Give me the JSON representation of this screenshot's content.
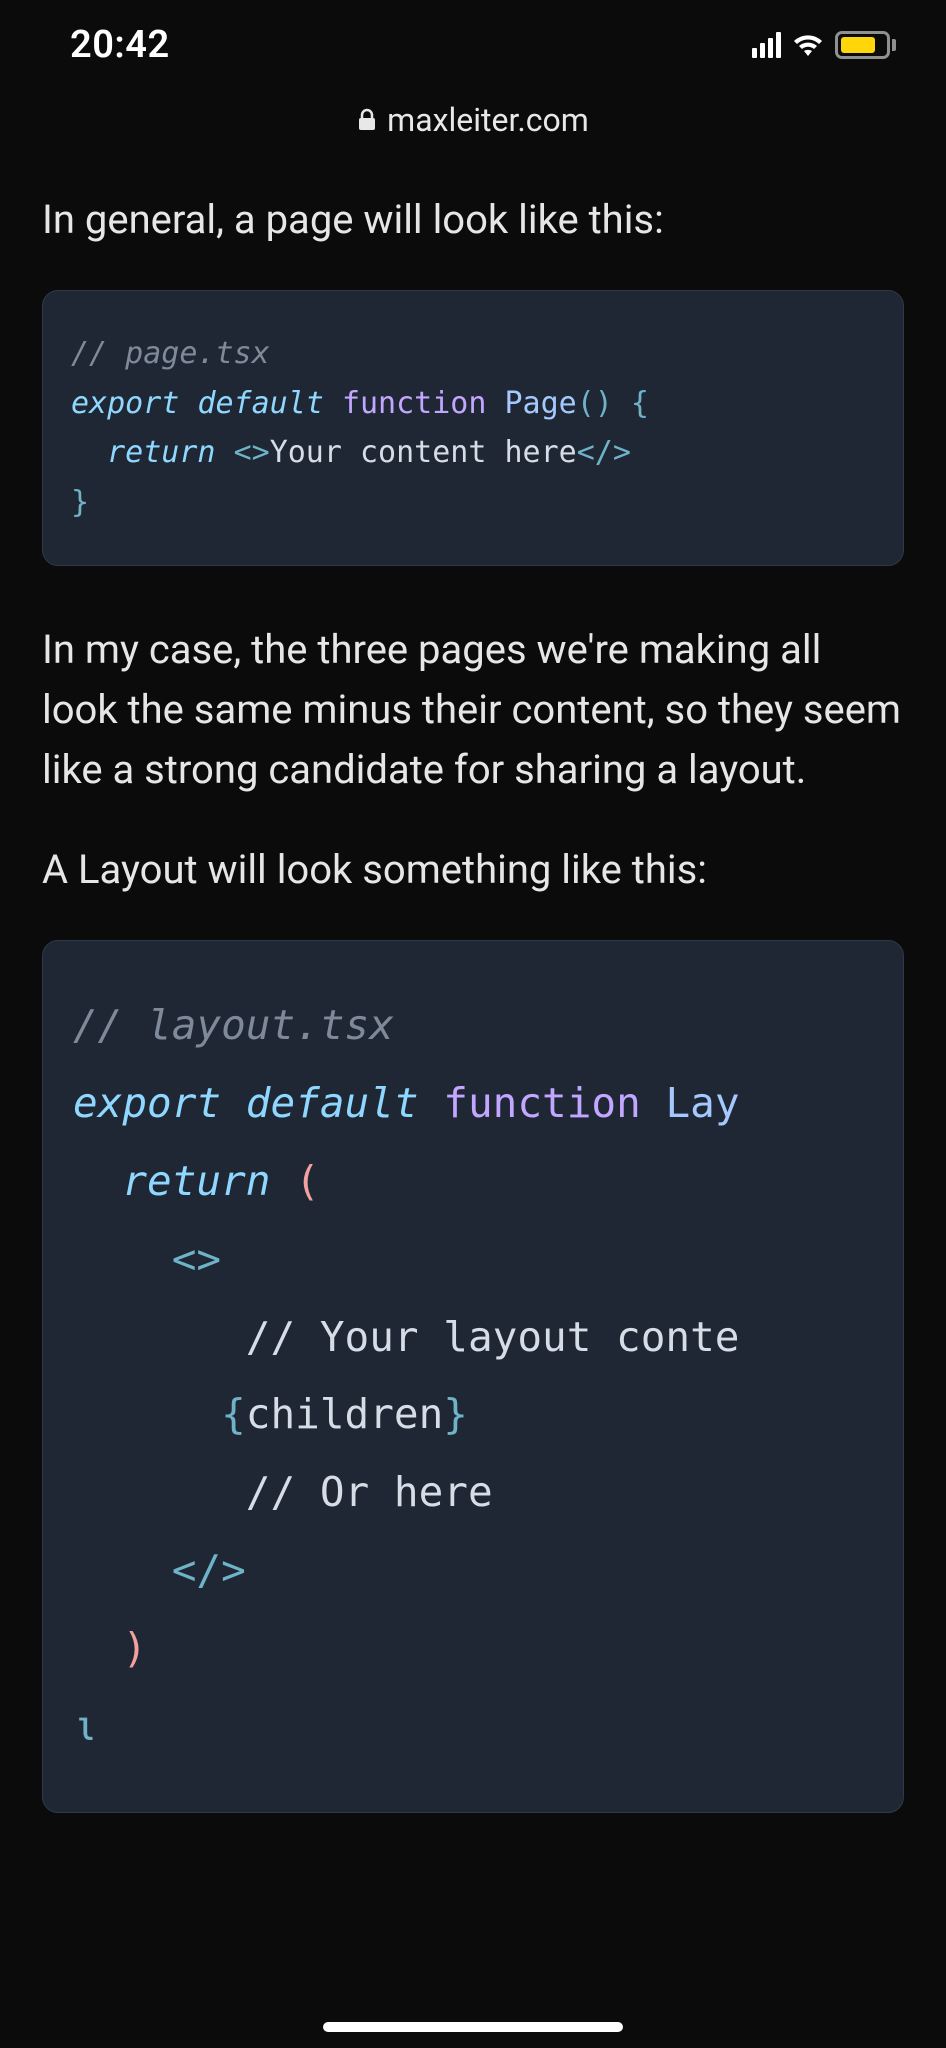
{
  "status": {
    "time": "20:42"
  },
  "url": {
    "domain": "maxleiter.com"
  },
  "paragraphs": {
    "p1": "In general, a page will look like this:",
    "p2": "In my case, the three pages we're making all look the same minus their content, so they seem like a strong candidate for sharing a layout.",
    "p3": "A Layout will look something like this:"
  },
  "code1": {
    "l1_comment": "// page.tsx",
    "l2_export": "export ",
    "l2_default": "default ",
    "l2_function": "function ",
    "l2_name": "Page",
    "l2_paren": "()",
    "l2_brace": " {",
    "l3_indent": "  ",
    "l3_return": "return ",
    "l3_open": "<>",
    "l3_text": "Your content here",
    "l3_close": "</>",
    "l4_brace": "}"
  },
  "code2": {
    "l1_comment": "// layout.tsx",
    "l2_export": "export ",
    "l2_default": "default ",
    "l2_function": "function ",
    "l2_name": "Lay",
    "l3_indent": "  ",
    "l3_return": "return ",
    "l3_paren": "(",
    "l4_indent": "    ",
    "l4_open": "<>",
    "l5_indent": "       ",
    "l5_text": "// Your layout conte",
    "l6_indent": "      ",
    "l6_open": "{",
    "l6_children": "children",
    "l6_close": "}",
    "l7_indent": "       ",
    "l7_text": "// Or here",
    "l8_indent": "    ",
    "l8_close": "</>",
    "l9_indent": "  ",
    "l9_paren": ")",
    "l10_brace": "ι"
  }
}
